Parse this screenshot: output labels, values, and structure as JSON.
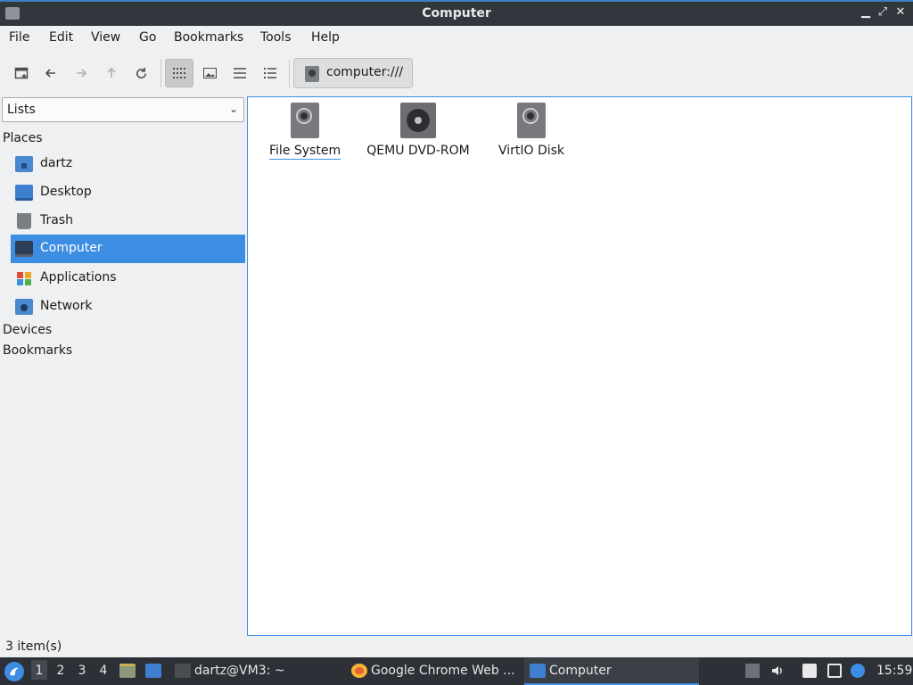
{
  "window": {
    "title": "Computer",
    "controls": {
      "minimize": "▁",
      "maximize": "⤢",
      "close": "✕"
    }
  },
  "menu": [
    "File",
    "Edit",
    "View",
    "Go",
    "Bookmarks",
    "Tools",
    "Help"
  ],
  "toolbar": {
    "new_tab_icon": "new-tab-icon",
    "location": "computer:///"
  },
  "sidebar": {
    "combo_value": "Lists",
    "combo_arrow": "⌄",
    "places_header": "Places",
    "places": [
      {
        "label": "dartz",
        "icon": "home-folder-icon"
      },
      {
        "label": "Desktop",
        "icon": "desktop-icon"
      },
      {
        "label": "Trash",
        "icon": "trash-icon"
      },
      {
        "label": "Computer",
        "icon": "computer-icon",
        "selected": true
      },
      {
        "label": "Applications",
        "icon": "applications-icon"
      },
      {
        "label": "Network",
        "icon": "network-icon"
      }
    ],
    "devices_header": "Devices",
    "bookmarks_header": "Bookmarks"
  },
  "main": {
    "items": [
      {
        "label": "File System",
        "icon": "harddisk-icon"
      },
      {
        "label": "QEMU DVD-ROM",
        "icon": "optical-drive-icon"
      },
      {
        "label": "VirtIO Disk",
        "icon": "harddisk-icon"
      }
    ]
  },
  "status": {
    "text": "3 item(s)"
  },
  "taskbar": {
    "workspaces": [
      "1",
      "2",
      "3",
      "4"
    ],
    "tasks": [
      {
        "label": "dartz@VM3: ~"
      },
      {
        "label": "Google Chrome Web ..."
      },
      {
        "label": "Computer"
      }
    ],
    "clock": "15:59"
  },
  "colors": {
    "accent": "#3d8ee3",
    "titlebar": "#32363d",
    "taskbar": "#2d3036"
  }
}
